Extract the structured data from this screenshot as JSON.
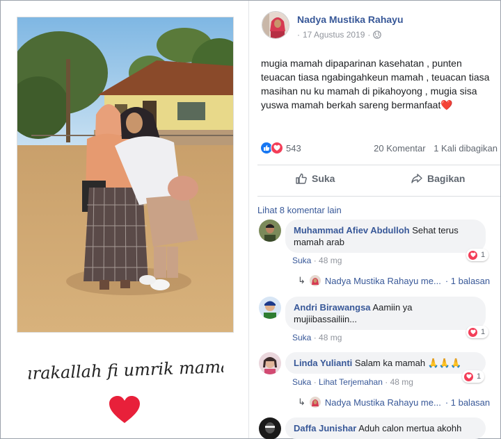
{
  "photo": {
    "caption_script": "Barakallah fi umrik mamah"
  },
  "post": {
    "author": "Nadya Mustika Rahayu",
    "date": "17 Agustus 2019",
    "text": "mugia mamah dipaparinan kasehatan , punten teuacan tiasa ngabingahkeun mamah , teuacan tiasa masihan nu ku mamah di pikahoyong , mugia sisa yuswa mamah berkah sareng bermanfaat❤️",
    "reaction_count": "543",
    "comments_count": "20 Komentar",
    "shares_count": "1 Kali dibagikan",
    "like_label": "Suka",
    "share_label": "Bagikan",
    "more_comments": "Lihat 8 komentar lain"
  },
  "comments": [
    {
      "name": "Muhammad Afiev Abdulloh",
      "text": "Sehat terus mamah arab",
      "like": "Suka",
      "time": "48 mg",
      "reactions": "1",
      "reply_author": "Nadya Mustika Rahayu me...",
      "reply_count": "· 1 balasan"
    },
    {
      "name": "Andri Birawangsa",
      "text": "Aamiin ya mujiibassailiin...",
      "like": "Suka",
      "time": "48 mg",
      "reactions": "1"
    },
    {
      "name": "Linda Yulianti",
      "text": "Salam ka mamah 🙏🙏🙏",
      "like": "Suka",
      "translate": "Lihat Terjemahan",
      "time": "48 mg",
      "reactions": "1",
      "reply_author": "Nadya Mustika Rahayu me...",
      "reply_count": "· 1 balasan"
    },
    {
      "name": "Daffa Junishar",
      "text": "Aduh calon mertua akohh"
    }
  ],
  "colors": {
    "link": "#385898",
    "like_blue": "#1877f2",
    "love_red": "#f33e58",
    "bubble_bg": "#f2f3f5"
  }
}
